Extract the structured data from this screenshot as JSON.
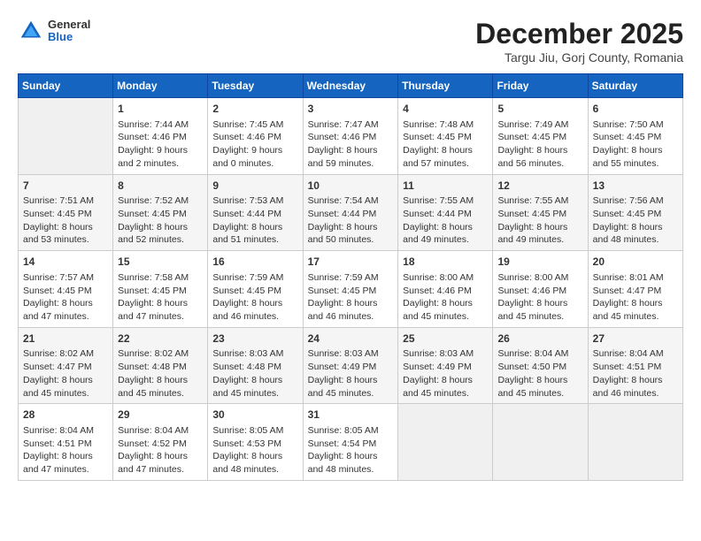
{
  "header": {
    "logo": {
      "general": "General",
      "blue": "Blue"
    },
    "title": "December 2025",
    "subtitle": "Targu Jiu, Gorj County, Romania"
  },
  "weekdays": [
    "Sunday",
    "Monday",
    "Tuesday",
    "Wednesday",
    "Thursday",
    "Friday",
    "Saturday"
  ],
  "weeks": [
    [
      {
        "day": "",
        "empty": true
      },
      {
        "day": "1",
        "sunrise": "Sunrise: 7:44 AM",
        "sunset": "Sunset: 4:46 PM",
        "daylight": "Daylight: 9 hours and 2 minutes."
      },
      {
        "day": "2",
        "sunrise": "Sunrise: 7:45 AM",
        "sunset": "Sunset: 4:46 PM",
        "daylight": "Daylight: 9 hours and 0 minutes."
      },
      {
        "day": "3",
        "sunrise": "Sunrise: 7:47 AM",
        "sunset": "Sunset: 4:46 PM",
        "daylight": "Daylight: 8 hours and 59 minutes."
      },
      {
        "day": "4",
        "sunrise": "Sunrise: 7:48 AM",
        "sunset": "Sunset: 4:45 PM",
        "daylight": "Daylight: 8 hours and 57 minutes."
      },
      {
        "day": "5",
        "sunrise": "Sunrise: 7:49 AM",
        "sunset": "Sunset: 4:45 PM",
        "daylight": "Daylight: 8 hours and 56 minutes."
      },
      {
        "day": "6",
        "sunrise": "Sunrise: 7:50 AM",
        "sunset": "Sunset: 4:45 PM",
        "daylight": "Daylight: 8 hours and 55 minutes."
      }
    ],
    [
      {
        "day": "7",
        "sunrise": "Sunrise: 7:51 AM",
        "sunset": "Sunset: 4:45 PM",
        "daylight": "Daylight: 8 hours and 53 minutes."
      },
      {
        "day": "8",
        "sunrise": "Sunrise: 7:52 AM",
        "sunset": "Sunset: 4:45 PM",
        "daylight": "Daylight: 8 hours and 52 minutes."
      },
      {
        "day": "9",
        "sunrise": "Sunrise: 7:53 AM",
        "sunset": "Sunset: 4:44 PM",
        "daylight": "Daylight: 8 hours and 51 minutes."
      },
      {
        "day": "10",
        "sunrise": "Sunrise: 7:54 AM",
        "sunset": "Sunset: 4:44 PM",
        "daylight": "Daylight: 8 hours and 50 minutes."
      },
      {
        "day": "11",
        "sunrise": "Sunrise: 7:55 AM",
        "sunset": "Sunset: 4:44 PM",
        "daylight": "Daylight: 8 hours and 49 minutes."
      },
      {
        "day": "12",
        "sunrise": "Sunrise: 7:55 AM",
        "sunset": "Sunset: 4:45 PM",
        "daylight": "Daylight: 8 hours and 49 minutes."
      },
      {
        "day": "13",
        "sunrise": "Sunrise: 7:56 AM",
        "sunset": "Sunset: 4:45 PM",
        "daylight": "Daylight: 8 hours and 48 minutes."
      }
    ],
    [
      {
        "day": "14",
        "sunrise": "Sunrise: 7:57 AM",
        "sunset": "Sunset: 4:45 PM",
        "daylight": "Daylight: 8 hours and 47 minutes."
      },
      {
        "day": "15",
        "sunrise": "Sunrise: 7:58 AM",
        "sunset": "Sunset: 4:45 PM",
        "daylight": "Daylight: 8 hours and 47 minutes."
      },
      {
        "day": "16",
        "sunrise": "Sunrise: 7:59 AM",
        "sunset": "Sunset: 4:45 PM",
        "daylight": "Daylight: 8 hours and 46 minutes."
      },
      {
        "day": "17",
        "sunrise": "Sunrise: 7:59 AM",
        "sunset": "Sunset: 4:45 PM",
        "daylight": "Daylight: 8 hours and 46 minutes."
      },
      {
        "day": "18",
        "sunrise": "Sunrise: 8:00 AM",
        "sunset": "Sunset: 4:46 PM",
        "daylight": "Daylight: 8 hours and 45 minutes."
      },
      {
        "day": "19",
        "sunrise": "Sunrise: 8:00 AM",
        "sunset": "Sunset: 4:46 PM",
        "daylight": "Daylight: 8 hours and 45 minutes."
      },
      {
        "day": "20",
        "sunrise": "Sunrise: 8:01 AM",
        "sunset": "Sunset: 4:47 PM",
        "daylight": "Daylight: 8 hours and 45 minutes."
      }
    ],
    [
      {
        "day": "21",
        "sunrise": "Sunrise: 8:02 AM",
        "sunset": "Sunset: 4:47 PM",
        "daylight": "Daylight: 8 hours and 45 minutes."
      },
      {
        "day": "22",
        "sunrise": "Sunrise: 8:02 AM",
        "sunset": "Sunset: 4:48 PM",
        "daylight": "Daylight: 8 hours and 45 minutes."
      },
      {
        "day": "23",
        "sunrise": "Sunrise: 8:03 AM",
        "sunset": "Sunset: 4:48 PM",
        "daylight": "Daylight: 8 hours and 45 minutes."
      },
      {
        "day": "24",
        "sunrise": "Sunrise: 8:03 AM",
        "sunset": "Sunset: 4:49 PM",
        "daylight": "Daylight: 8 hours and 45 minutes."
      },
      {
        "day": "25",
        "sunrise": "Sunrise: 8:03 AM",
        "sunset": "Sunset: 4:49 PM",
        "daylight": "Daylight: 8 hours and 45 minutes."
      },
      {
        "day": "26",
        "sunrise": "Sunrise: 8:04 AM",
        "sunset": "Sunset: 4:50 PM",
        "daylight": "Daylight: 8 hours and 45 minutes."
      },
      {
        "day": "27",
        "sunrise": "Sunrise: 8:04 AM",
        "sunset": "Sunset: 4:51 PM",
        "daylight": "Daylight: 8 hours and 46 minutes."
      }
    ],
    [
      {
        "day": "28",
        "sunrise": "Sunrise: 8:04 AM",
        "sunset": "Sunset: 4:51 PM",
        "daylight": "Daylight: 8 hours and 47 minutes."
      },
      {
        "day": "29",
        "sunrise": "Sunrise: 8:04 AM",
        "sunset": "Sunset: 4:52 PM",
        "daylight": "Daylight: 8 hours and 47 minutes."
      },
      {
        "day": "30",
        "sunrise": "Sunrise: 8:05 AM",
        "sunset": "Sunset: 4:53 PM",
        "daylight": "Daylight: 8 hours and 48 minutes."
      },
      {
        "day": "31",
        "sunrise": "Sunrise: 8:05 AM",
        "sunset": "Sunset: 4:54 PM",
        "daylight": "Daylight: 8 hours and 48 minutes."
      },
      {
        "day": "",
        "empty": true
      },
      {
        "day": "",
        "empty": true
      },
      {
        "day": "",
        "empty": true
      }
    ]
  ]
}
